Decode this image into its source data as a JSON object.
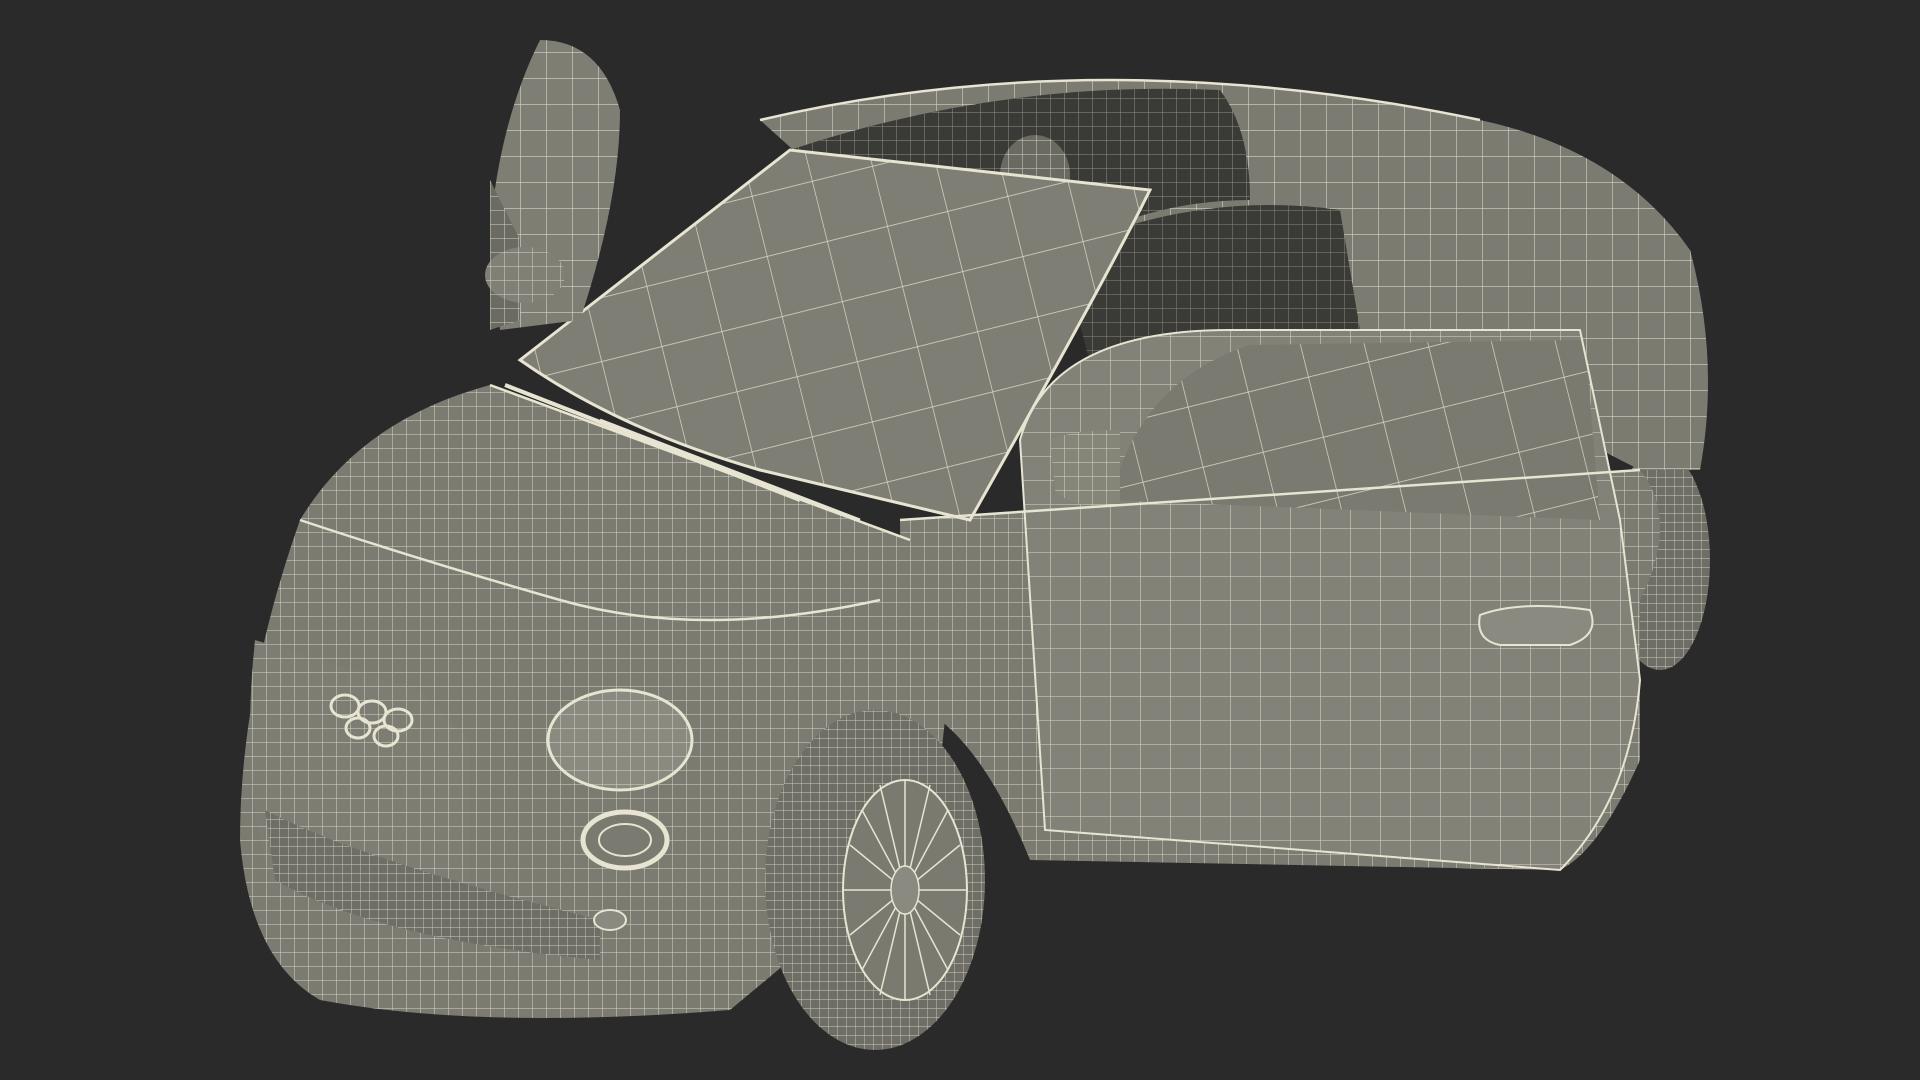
{
  "scene": {
    "subject": "car-wireframe-render",
    "colors": {
      "background": "#2a2a2a",
      "body": "#7b7b72",
      "body_light": "#8a8a80",
      "body_dark": "#5e5e57",
      "interior": "#3a3a36",
      "tire": "#6e6e66",
      "wire": "#e8e4d2"
    }
  }
}
